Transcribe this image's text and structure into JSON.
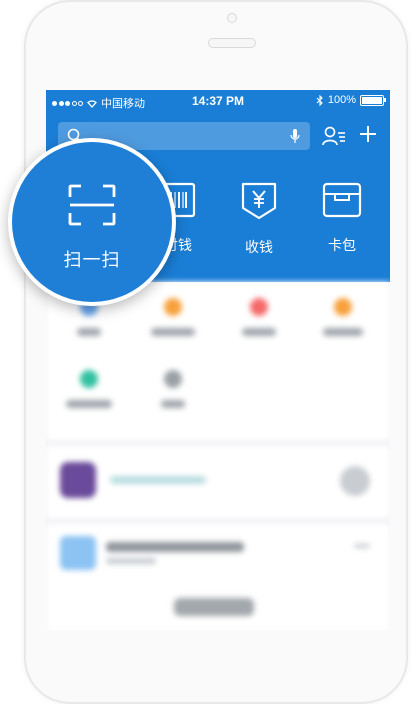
{
  "status_bar": {
    "carrier": "中国移动",
    "time": "14:37 PM",
    "battery": "100%"
  },
  "header": {
    "quick_actions": [
      {
        "label": "付钱",
        "icon": "barcode-icon"
      },
      {
        "label": "收钱",
        "icon": "yen-receive-icon"
      },
      {
        "label": "卡包",
        "icon": "card-wallet-icon"
      }
    ]
  },
  "magnifier": {
    "label": "扫一扫",
    "icon": "scan-icon"
  },
  "colors": {
    "header_blue": "#1a7ed6",
    "magnifier_blue": "#1f7fd7"
  }
}
